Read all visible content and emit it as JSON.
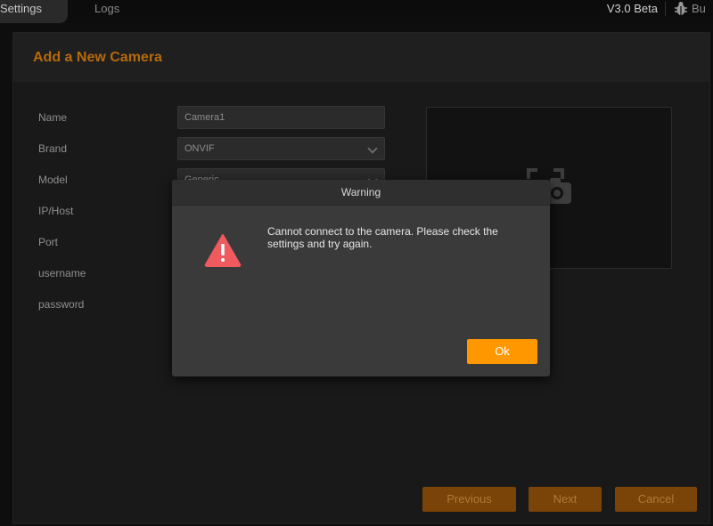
{
  "topbar": {
    "tabs": [
      {
        "label": "Settings"
      },
      {
        "label": "Logs"
      }
    ],
    "version": "V3.0 Beta",
    "bug_label": "Bu"
  },
  "panel": {
    "title": "Add a New Camera",
    "fields": [
      {
        "label": "Name",
        "value": "Camera1"
      },
      {
        "label": "Brand",
        "value": "ONVIF"
      },
      {
        "label": "Model",
        "value": "Generic"
      },
      {
        "label": "IP/Host"
      },
      {
        "label": "Port"
      },
      {
        "label": "username"
      },
      {
        "label": "password"
      }
    ],
    "buttons": {
      "previous": "Previous",
      "next": "Next",
      "cancel": "Cancel"
    }
  },
  "modal": {
    "title": "Warning",
    "message": "Cannot connect to the camera. Please check the settings and try again.",
    "ok": "Ok"
  },
  "colors": {
    "accent": "#ff9800",
    "accent_dim": "#7a4307",
    "title_orange": "#b66a0c",
    "danger": "#ef5a5f"
  },
  "icons": [
    "bug-icon",
    "chevron-down-icon",
    "camera-icon",
    "warning-icon"
  ]
}
